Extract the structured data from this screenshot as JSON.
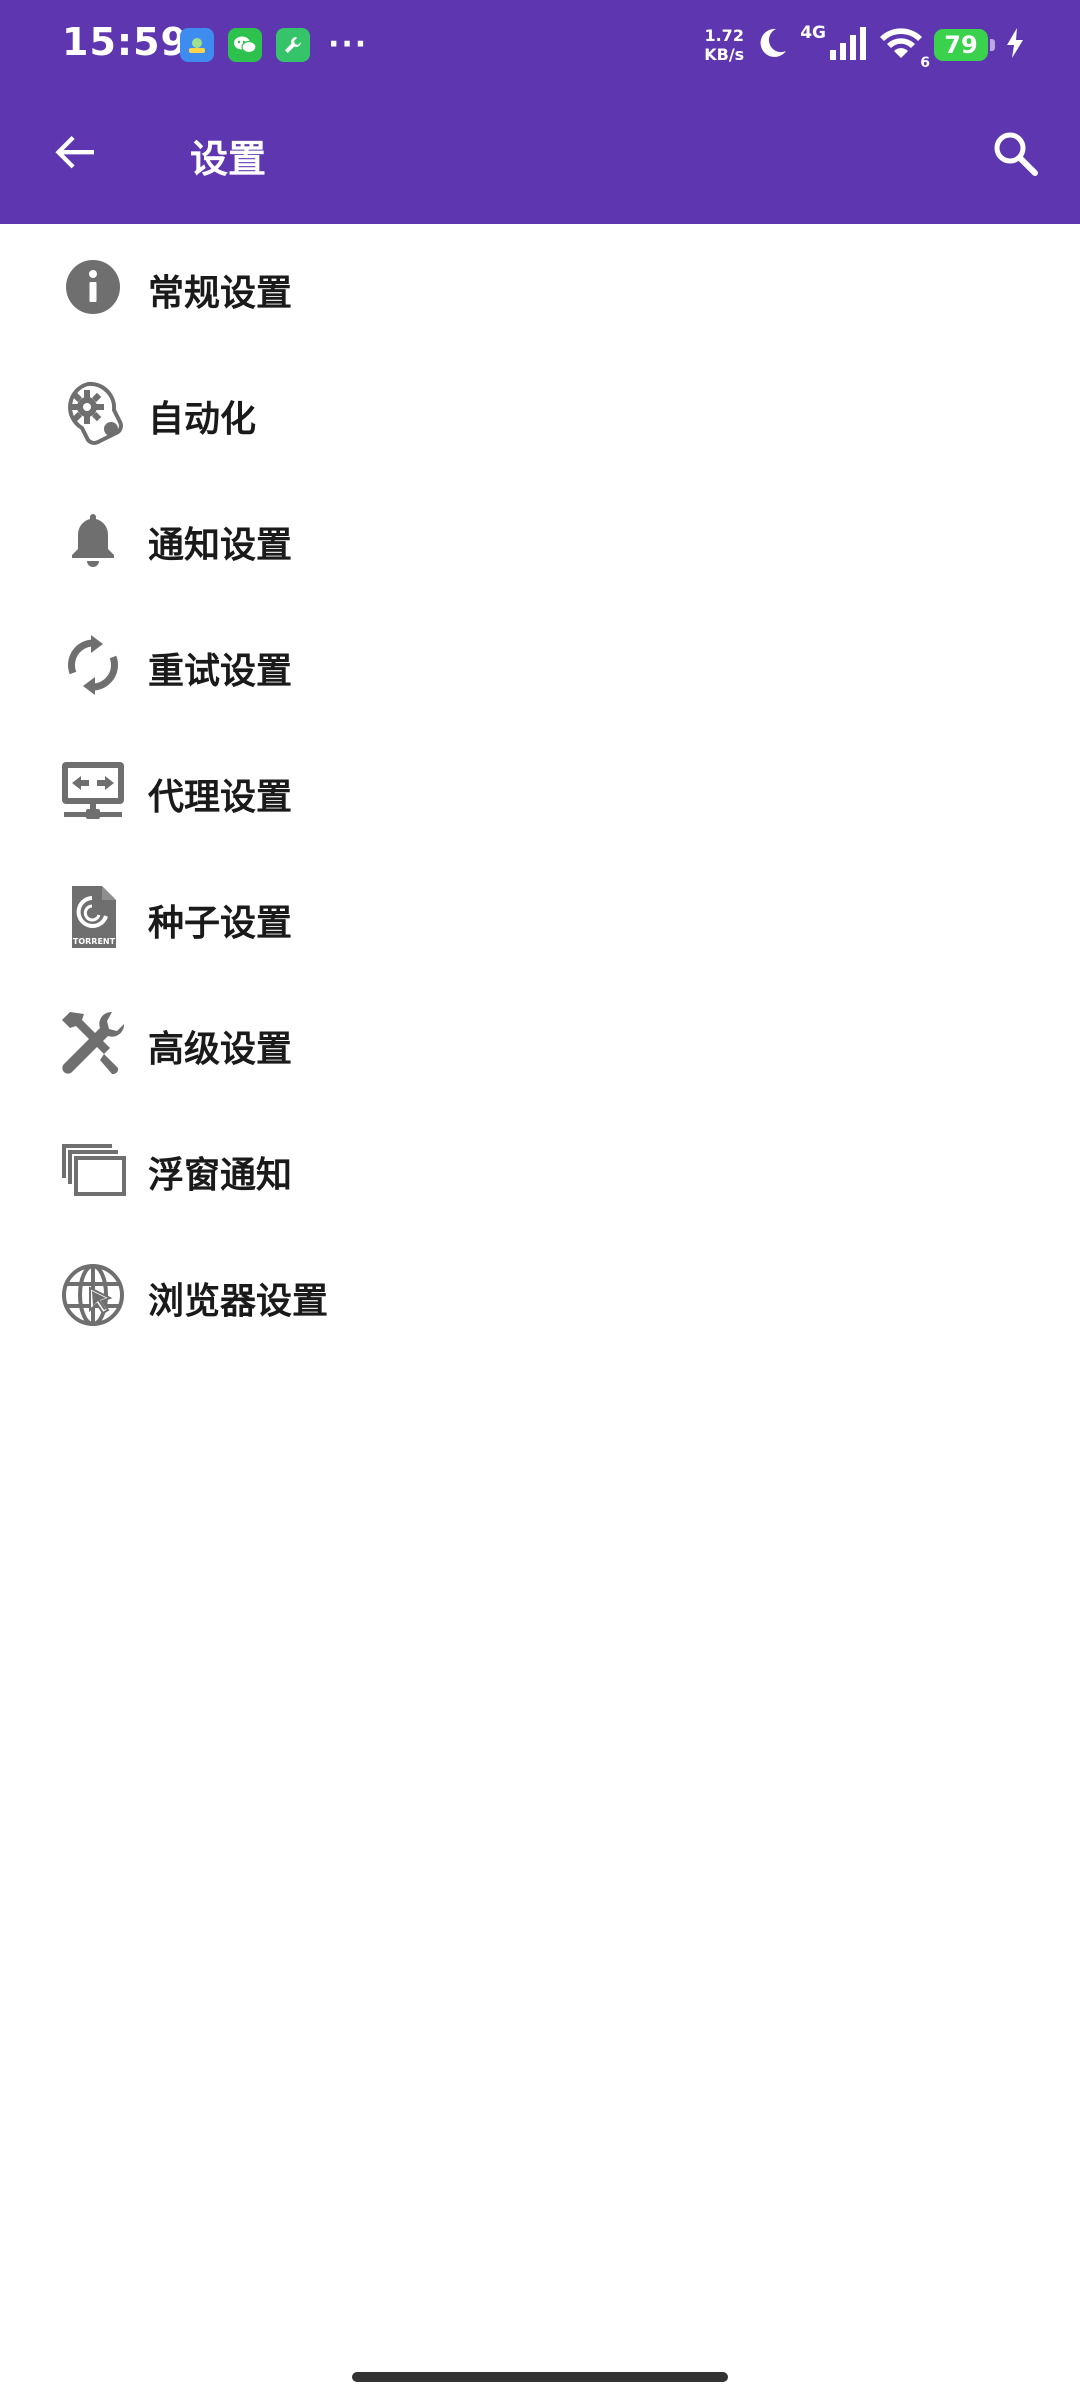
{
  "status_bar": {
    "time": "15:59",
    "more": "···",
    "speed_value": "1.72",
    "speed_unit": "KB/s",
    "network": "4G",
    "wifi_badge": "6",
    "battery": "79"
  },
  "app_bar": {
    "title": "设置"
  },
  "settings": [
    {
      "label": "常规设置",
      "icon": "info-icon"
    },
    {
      "label": "自动化",
      "icon": "automation-gear-icon"
    },
    {
      "label": "通知设置",
      "icon": "bell-icon"
    },
    {
      "label": "重试设置",
      "icon": "retry-icon"
    },
    {
      "label": "代理设置",
      "icon": "proxy-monitor-icon"
    },
    {
      "label": "种子设置",
      "icon": "torrent-file-icon"
    },
    {
      "label": "高级设置",
      "icon": "tools-icon"
    },
    {
      "label": "浮窗通知",
      "icon": "floating-windows-icon"
    },
    {
      "label": "浏览器设置",
      "icon": "browser-globe-icon"
    }
  ],
  "torrent_icon_text": "TORRENT",
  "colors": {
    "primary": "#5e36b0",
    "icon_gray": "#6f6f6f",
    "text": "#1a1a1a",
    "battery": "#3ad14d"
  }
}
